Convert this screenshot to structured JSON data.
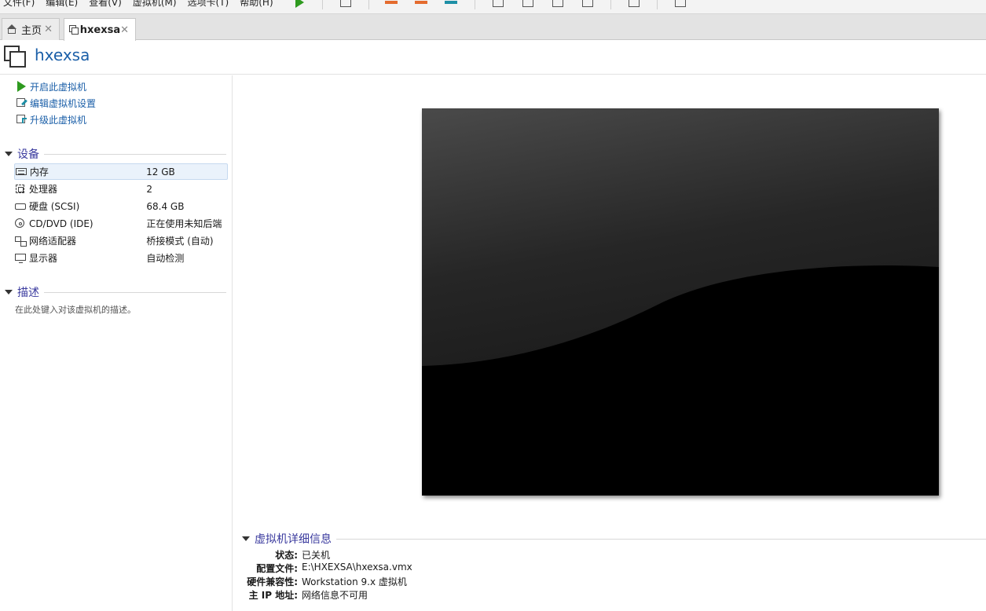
{
  "menubar": {
    "items": [
      "文件(F)",
      "编辑(E)",
      "查看(V)",
      "虚拟机(M)",
      "选项卡(T)",
      "帮助(H)"
    ]
  },
  "tabs": [
    {
      "label": "主页",
      "icon": "home-icon"
    },
    {
      "label": "hxexsa",
      "icon": "vm-icon"
    }
  ],
  "vm": {
    "title": "hxexsa"
  },
  "actions": [
    {
      "label": "开启此虚拟机",
      "icon": "play-icon"
    },
    {
      "label": "编辑虚拟机设置",
      "icon": "edit-settings-icon"
    },
    {
      "label": "升级此虚拟机",
      "icon": "upgrade-icon"
    }
  ],
  "devices": {
    "heading": "设备",
    "rows": [
      {
        "name": "内存",
        "value": "12 GB",
        "icon": "memory-icon"
      },
      {
        "name": "处理器",
        "value": "2",
        "icon": "processor-icon"
      },
      {
        "name": "硬盘 (SCSI)",
        "value": "68.4 GB",
        "icon": "hard-disk-icon"
      },
      {
        "name": "CD/DVD (IDE)",
        "value": "正在使用未知后端",
        "icon": "cd-dvd-icon"
      },
      {
        "name": "网络适配器",
        "value": "桥接模式 (自动)",
        "icon": "network-adapter-icon"
      },
      {
        "name": "显示器",
        "value": "自动检测",
        "icon": "display-icon"
      }
    ]
  },
  "description": {
    "heading": "描述",
    "placeholder": "在此处键入对该虚拟机的描述。"
  },
  "details": {
    "heading": "虚拟机详细信息",
    "rows": [
      {
        "key": "状态:",
        "value": "已关机"
      },
      {
        "key": "配置文件:",
        "value": "E:\\HXEXSA\\hxexsa.vmx"
      },
      {
        "key": "硬件兼容性:",
        "value": "Workstation 9.x 虚拟机"
      },
      {
        "key": "主 IP 地址:",
        "value": "网络信息不可用"
      }
    ]
  },
  "colors": {
    "link": "#1b5fa8",
    "section": "#3a3a9e",
    "play": "#2e9a1f"
  }
}
